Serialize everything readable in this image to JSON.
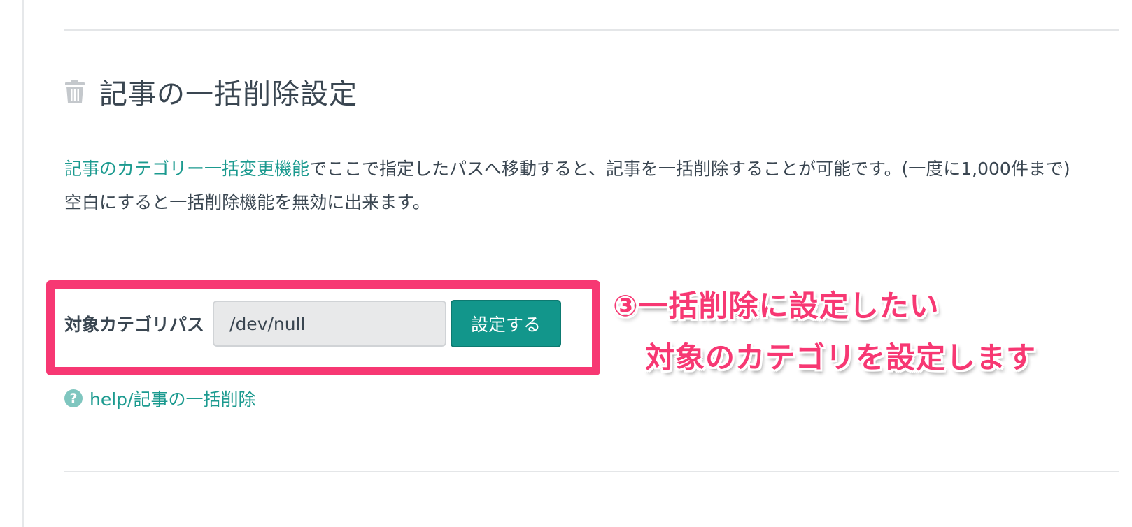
{
  "section": {
    "title": "記事の一括削除設定",
    "icon": "trash-icon"
  },
  "description": {
    "link_text": "記事のカテゴリー一括変更機能",
    "line1_rest": "でここで指定したパスへ移動すると、記事を一括削除することが可能です。(一度に1,000件まで)",
    "line2": "空白にすると一括削除機能を無効に出来ます。"
  },
  "form": {
    "label": "対象カテゴリパス",
    "input_value": "/dev/null",
    "submit_label": "設定する"
  },
  "annotation": {
    "line1": "③一括削除に設定したい",
    "line2": "対象のカテゴリを設定します",
    "color": "#f73873"
  },
  "help": {
    "icon": "question-circle-icon",
    "label": "help/記事の一括削除"
  },
  "colors": {
    "accent": "#12968b",
    "link": "#1b9a8f",
    "highlight": "#f73873"
  }
}
